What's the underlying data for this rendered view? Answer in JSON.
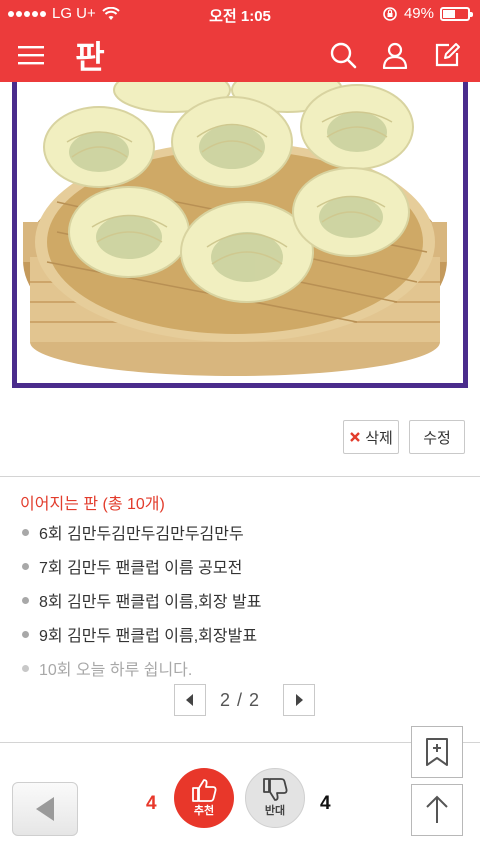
{
  "status_bar": {
    "carrier": "LG U+",
    "time": "오전 1:05",
    "battery": "49%"
  },
  "navbar": {
    "logo": "판"
  },
  "post_actions": {
    "delete_label": "삭제",
    "edit_label": "수정"
  },
  "series": {
    "title": "이어지는 판 (총 10개)",
    "items": [
      {
        "label": "6회 김만두김만두김만두김만두"
      },
      {
        "label": "7회 김만두 팬클럽 이름 공모전"
      },
      {
        "label": "8회 김만두 팬클럽 이름,회장 발표"
      },
      {
        "label": "9회 김만두 팬클럽 이름,회장발표"
      },
      {
        "label": "10회 오늘 하루 쉽니다."
      }
    ],
    "pager": "2 / 2"
  },
  "votes": {
    "up_count": "4",
    "up_label": "추천",
    "down_label": "반대",
    "down_count": "4"
  },
  "colors": {
    "brand": "#ec3b3b",
    "series_title": "#e23c2c",
    "frame": "#4a2c8c"
  }
}
